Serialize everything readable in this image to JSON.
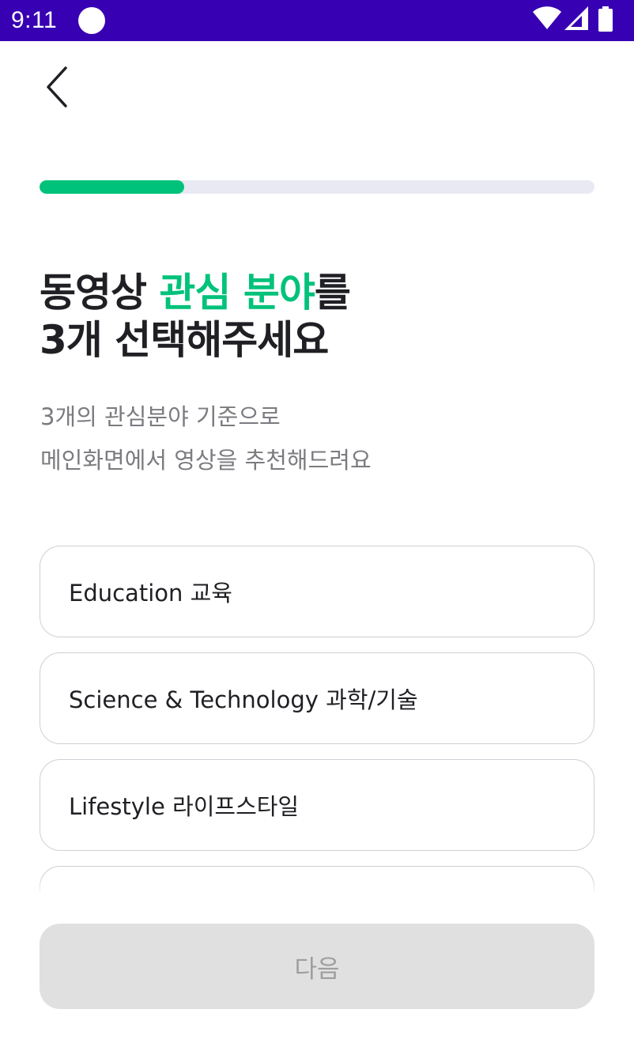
{
  "status_bar": {
    "time": "9:11",
    "background": "#3700b3",
    "icons": [
      "circle-icon",
      "wifi-icon",
      "signal-icon",
      "battery-icon"
    ]
  },
  "nav": {
    "back_icon": "chevron-left-icon"
  },
  "progress": {
    "value_fraction": 0.26,
    "fill_color": "#00c27a",
    "track_color": "#e8e9f2"
  },
  "headline": {
    "part1": "동영상 ",
    "accent": "관심 분야",
    "part2": "를",
    "line2": "3개 선택해주세요",
    "accent_color": "#00c27a"
  },
  "subtitle": {
    "line1": "3개의 관심분야 기준으로",
    "line2": "메인화면에서 영상을 추천해드려요"
  },
  "options": [
    {
      "label": "Education 교육"
    },
    {
      "label": "Science & Technology 과학/기술"
    },
    {
      "label": "Lifestyle 라이프스타일"
    },
    {
      "label": ""
    }
  ],
  "next_button": {
    "label": "다음",
    "state": "disabled"
  }
}
